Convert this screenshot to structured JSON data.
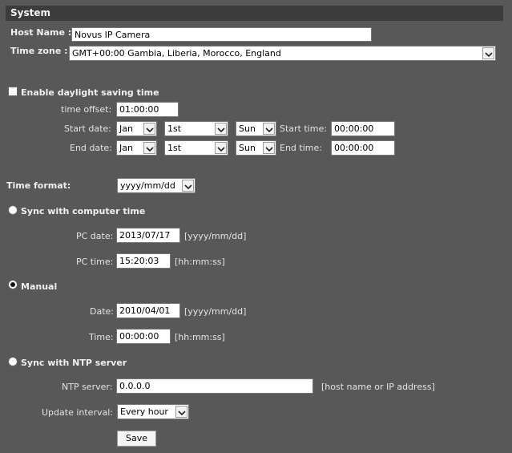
{
  "section_title": "System",
  "host_name": {
    "label": "Host Name :",
    "value": "Novus IP Camera"
  },
  "time_zone": {
    "label": "Time zone :",
    "value": "GMT+00:00 Gambia, Liberia, Morocco, England"
  },
  "dst": {
    "label": "Enable daylight saving time",
    "checked": false,
    "offset_label": "time offset:",
    "offset_value": "01:00:00",
    "start": {
      "label": "Start date:",
      "month": "Jan",
      "week": "1st",
      "day": "Sun",
      "time_label": "Start time:",
      "time": "00:00:00"
    },
    "end": {
      "label": "End date:",
      "month": "Jan",
      "week": "1st",
      "day": "Sun",
      "time_label": "End time:",
      "time": "00:00:00"
    }
  },
  "time_format": {
    "label": "Time format:",
    "value": "yyyy/mm/dd"
  },
  "sync_pc": {
    "label": "Sync with computer time",
    "selected": false,
    "date_label": "PC date:",
    "date_value": "2013/07/17",
    "date_hint": "[yyyy/mm/dd]",
    "time_label": "PC time:",
    "time_value": "15:20:03",
    "time_hint": "[hh:mm:ss]"
  },
  "manual": {
    "label": "Manual",
    "selected": true,
    "date_label": "Date:",
    "date_value": "2010/04/01",
    "date_hint": "[yyyy/mm/dd]",
    "time_label": "Time:",
    "time_value": "00:00:00",
    "time_hint": "[hh:mm:ss]"
  },
  "ntp": {
    "label": "Sync with NTP server",
    "selected": false,
    "server_label": "NTP server:",
    "server_value": "0.0.0.0",
    "server_hint": "[host name or IP address]",
    "interval_label": "Update interval:",
    "interval_value": "Every hour"
  },
  "save_label": "Save"
}
